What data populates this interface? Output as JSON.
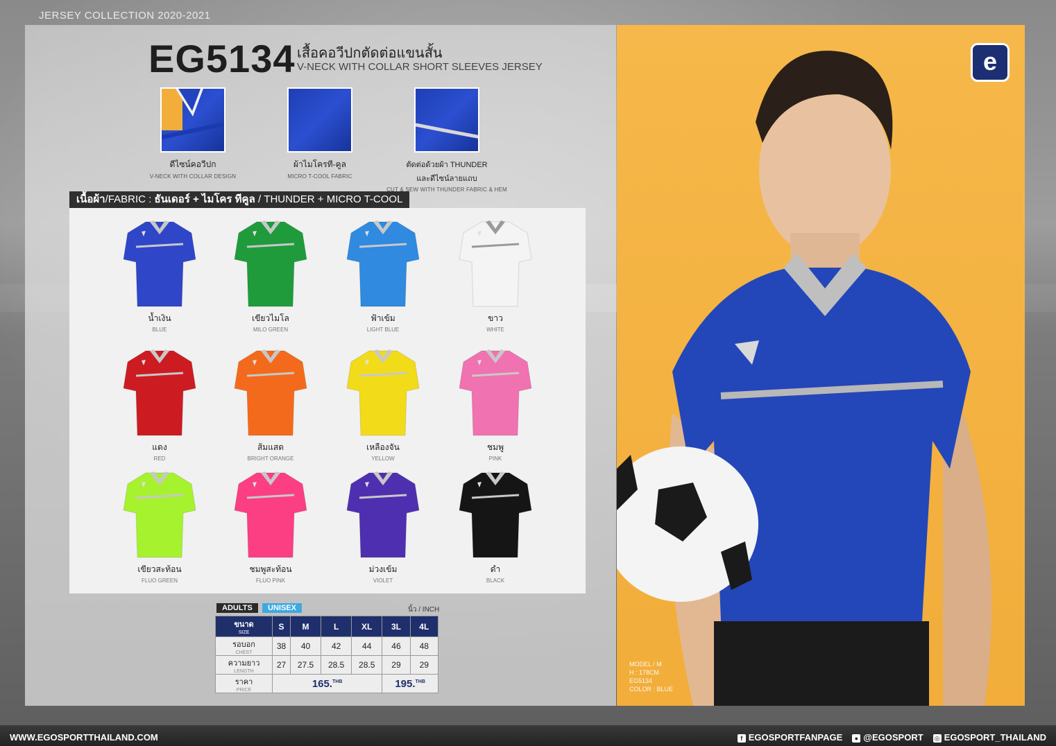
{
  "header": {
    "collection": "JERSEY COLLECTION 2020-2021",
    "model_code": "EG5134",
    "title_th": "เสื้อคอวีปกตัดต่อแขนสั้น",
    "title_en": "V-NECK WITH COLLAR SHORT SLEEVES JERSEY"
  },
  "features": [
    {
      "th": "ดีไซน์คอวีปก",
      "en": "V-NECK WITH COLLAR DESIGN"
    },
    {
      "th": "ผ้าไมโครที-คูล",
      "en": "MICRO T-COOL FABRIC"
    },
    {
      "th": "ตัดต่อด้วยผ้า THUNDER",
      "th2": "และดีไซน์ลายแถบ",
      "en": "CUT & SEW WITH THUNDER FABRIC & HEM"
    }
  ],
  "fabric": {
    "label_th": "เนื้อผ้า",
    "label_en": "/FABRIC : ",
    "value_th": "ธันเดอร์ + ไมโคร ทีคูล",
    "value_en": " / THUNDER + MICRO T-COOL"
  },
  "colors": [
    {
      "th": "น้ำเงิน",
      "en": "BLUE",
      "hex": "#2f46c8"
    },
    {
      "th": "เขียวไมโล",
      "en": "MILO GREEN",
      "hex": "#1f9b3c"
    },
    {
      "th": "ฟ้าเข้ม",
      "en": "LIGHT BLUE",
      "hex": "#2f8ae0"
    },
    {
      "th": "ขาว",
      "en": "WHITE",
      "hex": "#f4f4f4"
    },
    {
      "th": "แดง",
      "en": "RED",
      "hex": "#cc1c22"
    },
    {
      "th": "ส้มแสด",
      "en": "BRIGHT ORANGE",
      "hex": "#f46a1c"
    },
    {
      "th": "เหลืองจัน",
      "en": "YELLOW",
      "hex": "#f2dc1a"
    },
    {
      "th": "ชมพู",
      "en": "PINK",
      "hex": "#f072b0"
    },
    {
      "th": "เขียวสะท้อน",
      "en": "FLUO GREEN",
      "hex": "#a6f22e"
    },
    {
      "th": "ชมพูสะท้อน",
      "en": "FLUO PINK",
      "hex": "#fb3f82"
    },
    {
      "th": "ม่วงเข้ม",
      "en": "VIOLET",
      "hex": "#4e2fb0"
    },
    {
      "th": "ดำ",
      "en": "BLACK",
      "hex": "#151515"
    }
  ],
  "size_table": {
    "badge_adults": "ADULTS",
    "badge_unisex": "UNISEX",
    "unit": "นิ้ว / INCH",
    "header_th": "ขนาด",
    "header_en": "SIZE",
    "sizes": [
      "S",
      "M",
      "L",
      "XL",
      "3L",
      "4L"
    ],
    "rows": [
      {
        "th": "รอบอก",
        "en": "CHEST",
        "values": [
          "38",
          "40",
          "42",
          "44",
          "46",
          "48"
        ]
      },
      {
        "th": "ความยาว",
        "en": "LENGTH",
        "values": [
          "27",
          "27.5",
          "28.5",
          "28.5",
          "29",
          "29"
        ]
      }
    ],
    "price_th": "ราคา",
    "price_en": "PRICE",
    "price_1": "165.",
    "price_2": "195.",
    "currency": "THB"
  },
  "model": {
    "line1": "MODEL / M",
    "line2": "H : 178CM",
    "line3": "EG5134",
    "line4": "COLOR : BLUE"
  },
  "footer": {
    "website": "WWW.EGOSPORTTHAILAND.COM",
    "facebook": "EGOSPORTFANPAGE",
    "line": "@EGOSPORT",
    "instagram": "EGOSPORT_THAILAND"
  },
  "accent": {
    "navy": "#1f2f6b",
    "cyan": "#3ea9e0",
    "orange": "#f4b042"
  }
}
